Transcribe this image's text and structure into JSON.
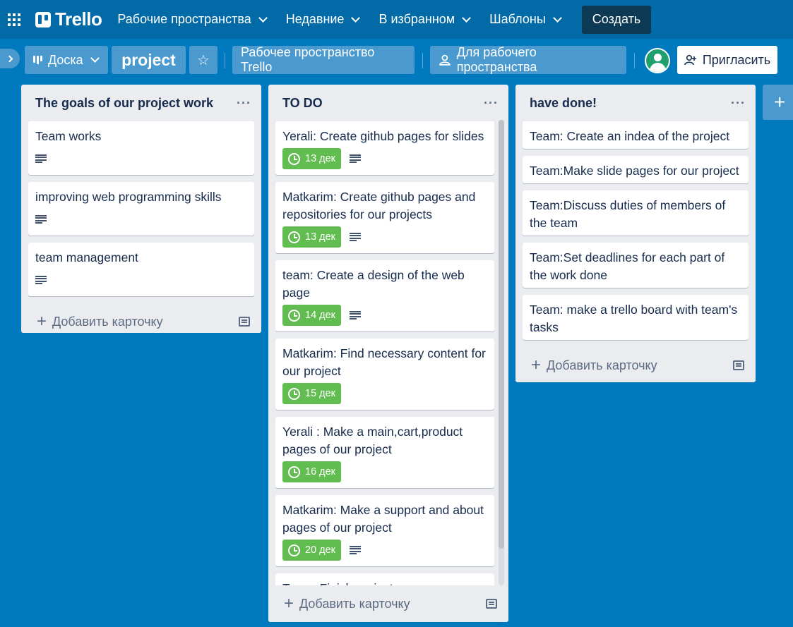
{
  "header": {
    "logo": "Trello",
    "nav": [
      {
        "label": "Рабочие пространства"
      },
      {
        "label": "Недавние"
      },
      {
        "label": "В избранном"
      },
      {
        "label": "Шаблоны"
      }
    ],
    "create_label": "Создать"
  },
  "board_header": {
    "view_label": "Доска",
    "board_title": "project",
    "workspace_label": "Рабочее пространство Trello",
    "visibility_label": "Для рабочего пространства",
    "invite_label": "Пригласить"
  },
  "lists": [
    {
      "title": "The goals of our project work",
      "cards": [
        {
          "title": "Team works",
          "due": null,
          "has_desc": true
        },
        {
          "title": "improving web programming skills",
          "due": null,
          "has_desc": true
        },
        {
          "title": "team management",
          "due": null,
          "has_desc": true
        }
      ],
      "add_label": "Добавить карточку"
    },
    {
      "title": "TO DO",
      "cards": [
        {
          "title": "Yerali: Create github pages for slides",
          "due": "13 дек",
          "has_desc": true
        },
        {
          "title": "Matkarim: Create github pages and repositories for our projects",
          "due": "13 дек",
          "has_desc": true
        },
        {
          "title": "team: Create a design of the web page",
          "due": "14 дек",
          "has_desc": true
        },
        {
          "title": "Matkarim: Find necessary content for our project",
          "due": "15 дек",
          "has_desc": false
        },
        {
          "title": "Yerali : Make a main,cart,product pages of our project",
          "due": "16 дек",
          "has_desc": false
        },
        {
          "title": "Matkarim: Make a support and about pages of our project",
          "due": "20 дек",
          "has_desc": true
        },
        {
          "title": "Team: Finish project",
          "due": null,
          "has_desc": false
        }
      ],
      "add_label": "Добавить карточку"
    },
    {
      "title": "have done!",
      "cards": [
        {
          "title": "Team: Create an indea of the project",
          "due": null,
          "has_desc": false
        },
        {
          "title": "Team:Make slide pages for our project",
          "due": null,
          "has_desc": false
        },
        {
          "title": "Team:Discuss duties of members of the team",
          "due": null,
          "has_desc": false
        },
        {
          "title": "Team:Set deadlines for each part of the work done",
          "due": null,
          "has_desc": false
        },
        {
          "title": "Team: make a trello board with team's tasks",
          "due": null,
          "has_desc": false
        }
      ],
      "add_label": "Добавить карточку"
    }
  ],
  "add_list_label": "+",
  "colors": {
    "board_bg": "#0079bf",
    "header_bg": "#026aa7",
    "due_badge": "#61bd4f",
    "list_bg": "#ebecf0",
    "avatar": "#1fa06c"
  }
}
